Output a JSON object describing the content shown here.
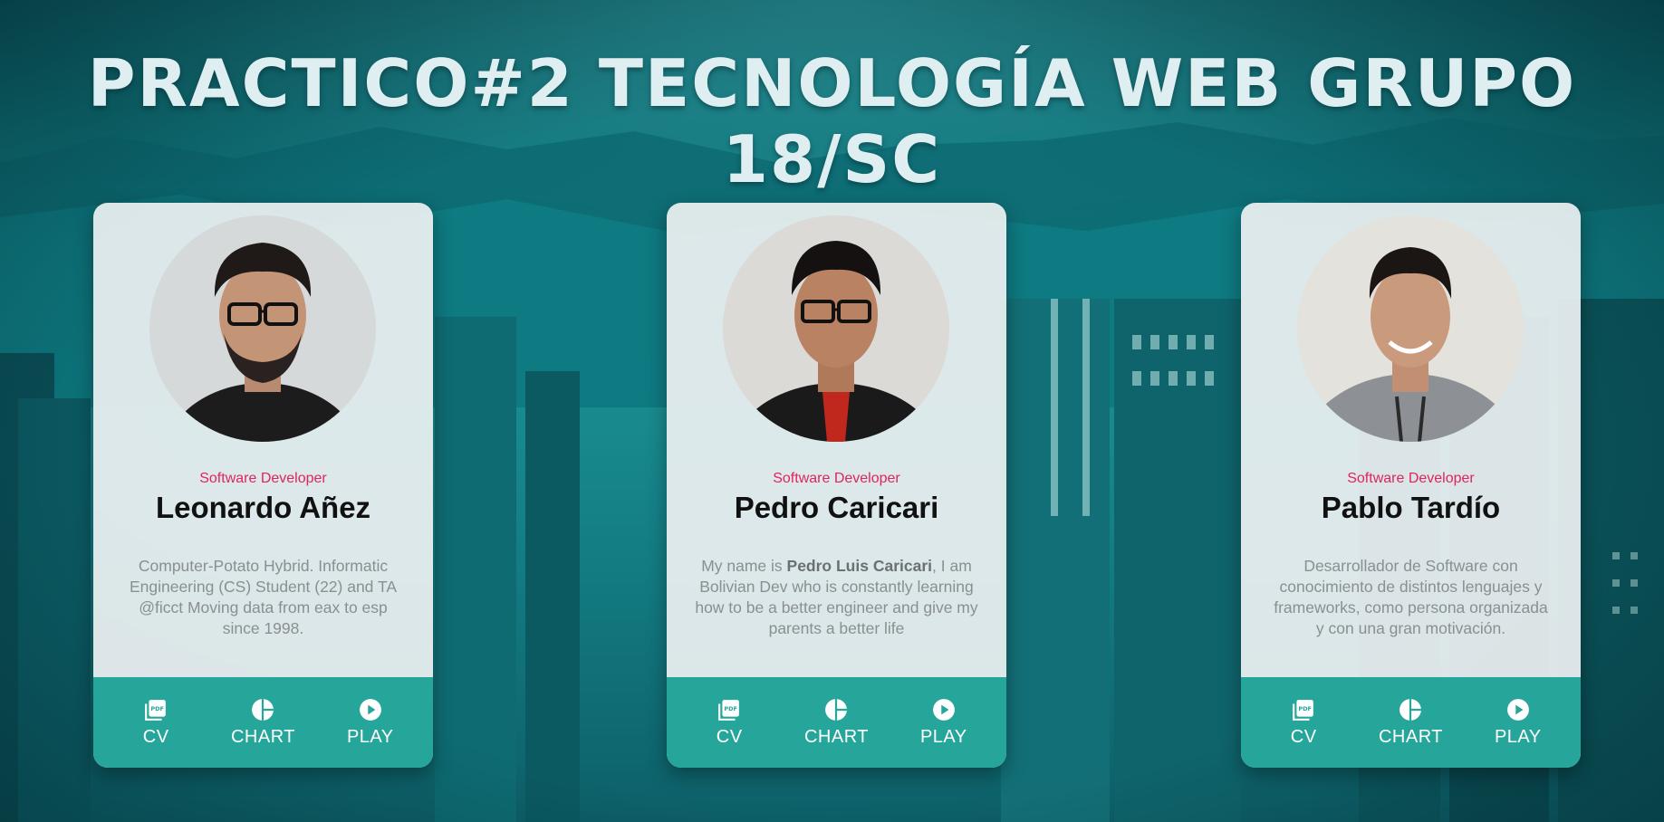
{
  "page": {
    "title": "PRACTICO#2 TECNOLOGÍA WEB GRUPO 18/SC"
  },
  "colors": {
    "accent_teal": "#26a69a",
    "role_pink": "#e0245e",
    "card_bg": "#ecf0f1"
  },
  "cards": [
    {
      "role": "Software Developer",
      "name": "Leonardo Añez",
      "bio_plain": "Computer-Potato Hybrid. Informatic Engineering (CS) Student (22) and TA @ficct Moving data from eax to esp since 1998.",
      "actions": [
        {
          "label": "CV",
          "icon": "pdf-icon"
        },
        {
          "label": "CHART",
          "icon": "pie-chart-icon"
        },
        {
          "label": "PLAY",
          "icon": "play-icon"
        }
      ]
    },
    {
      "role": "Software Developer",
      "name": "Pedro Caricari",
      "bio_prefix": "My name is ",
      "bio_bold": "Pedro Luis Caricari",
      "bio_suffix": ", I am Bolivian Dev who is constantly learning how to be a better engineer and give my parents a better life",
      "actions": [
        {
          "label": "CV",
          "icon": "pdf-icon"
        },
        {
          "label": "CHART",
          "icon": "pie-chart-icon"
        },
        {
          "label": "PLAY",
          "icon": "play-icon"
        }
      ]
    },
    {
      "role": "Software Developer",
      "name": "Pablo Tardío",
      "bio_plain": "Desarrollador de Software con conocimiento de distintos lenguajes y frameworks, como persona organizada y con una gran motivación.",
      "actions": [
        {
          "label": "CV",
          "icon": "pdf-icon"
        },
        {
          "label": "CHART",
          "icon": "pie-chart-icon"
        },
        {
          "label": "PLAY",
          "icon": "play-icon"
        }
      ]
    }
  ]
}
